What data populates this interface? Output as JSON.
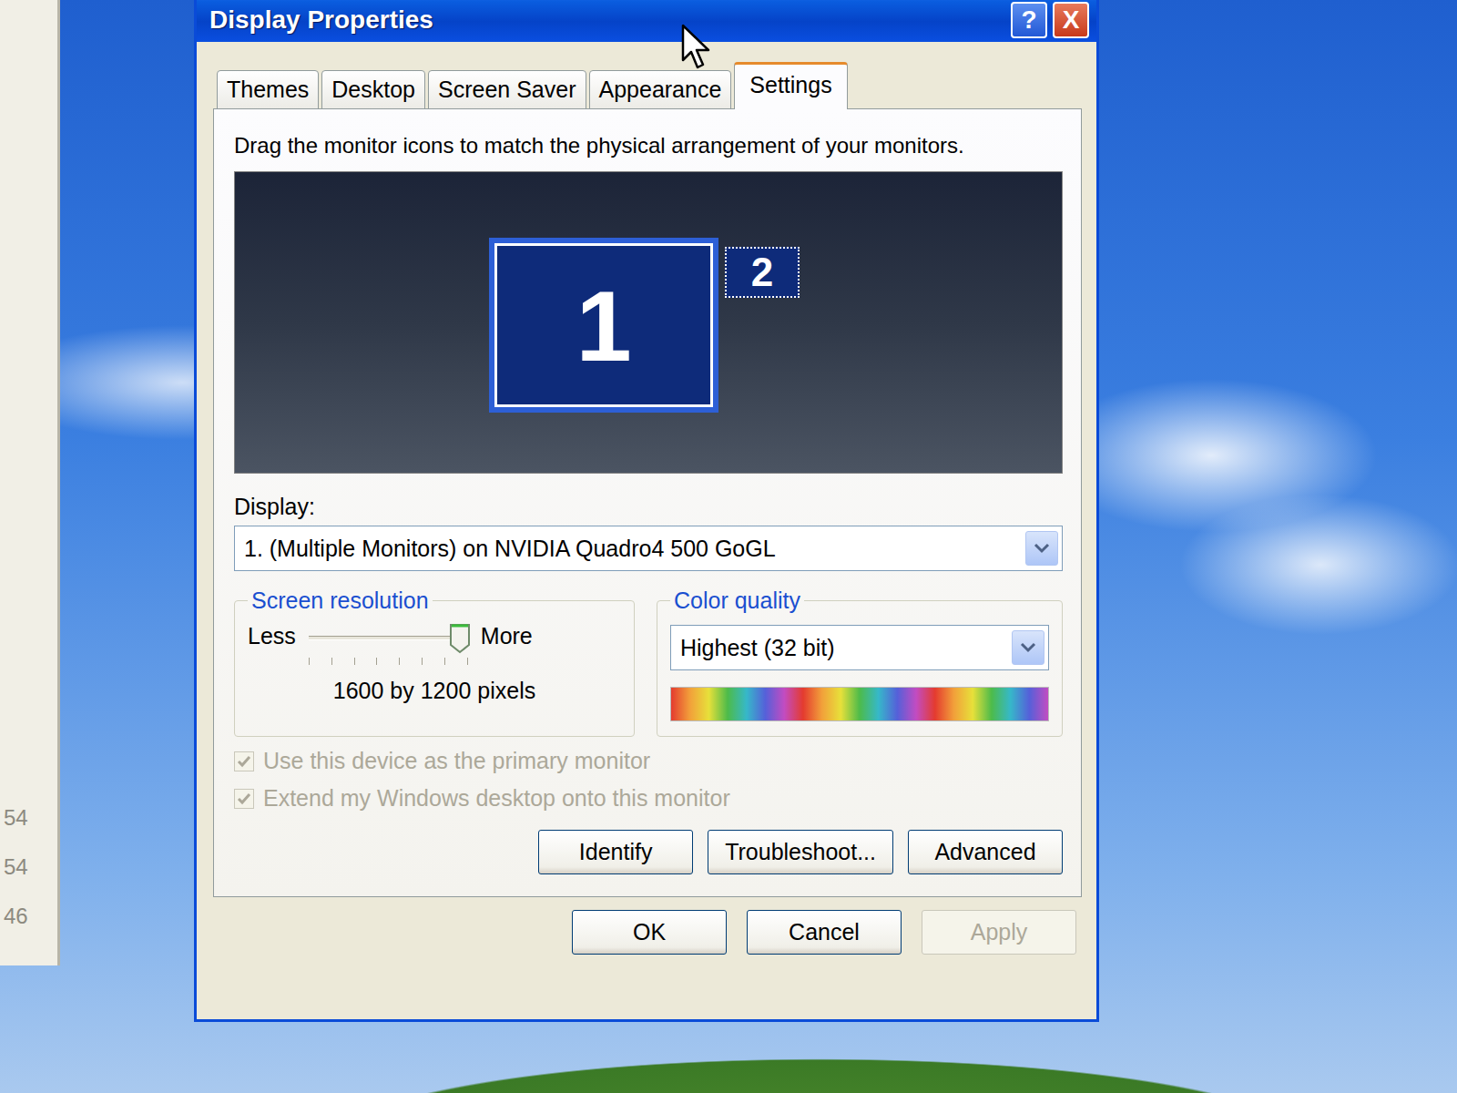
{
  "desktop": {
    "left_window_texts": [
      "54",
      "54",
      "46"
    ]
  },
  "window": {
    "title": "Display Properties",
    "controls": [
      "?",
      "X"
    ]
  },
  "tabs": [
    {
      "label": "Themes",
      "selected": false
    },
    {
      "label": "Desktop",
      "selected": false
    },
    {
      "label": "Screen Saver",
      "selected": false
    },
    {
      "label": "Appearance",
      "selected": false
    },
    {
      "label": "Settings",
      "selected": true
    }
  ],
  "instruction": "Drag the monitor icons to match the physical arrangement of your monitors.",
  "monitors": [
    {
      "label": "1",
      "selected": true
    },
    {
      "label": "2",
      "selected": false
    }
  ],
  "display": {
    "label": "Display:",
    "value": "1. (Multiple Monitors) on NVIDIA Quadro4 500 GoGL"
  },
  "resolution": {
    "title": "Screen resolution",
    "less": "Less",
    "more": "More",
    "level": 0.95,
    "reading": "1600 by 1200 pixels"
  },
  "color_quality": {
    "title": "Color quality",
    "value": "Highest (32 bit)"
  },
  "checkboxes": [
    {
      "label": "Use this device as the primary monitor",
      "checked": true,
      "disabled": true
    },
    {
      "label": "Extend my Windows desktop onto this monitor",
      "checked": true,
      "disabled": true
    }
  ],
  "panel_buttons": [
    "Identify",
    "Troubleshoot...",
    "Advanced"
  ],
  "buttons": [
    {
      "label": "OK",
      "disabled": false
    },
    {
      "label": "Cancel",
      "disabled": false
    },
    {
      "label": "Apply",
      "disabled": true
    }
  ]
}
